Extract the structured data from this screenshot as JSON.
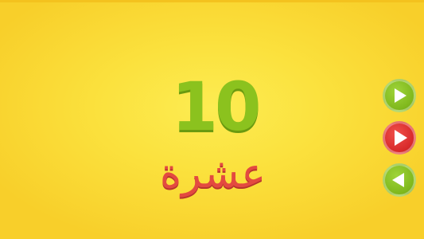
{
  "card": {
    "numeral": "10",
    "word": "عشرة"
  },
  "colors": {
    "background": "#fbe13d",
    "numeral": "#8bc21e",
    "word": "#e34a40",
    "nav_green": "#7fb81c",
    "play_red": "#d8292a"
  },
  "controls": {
    "next_icon": "next-arrow-icon",
    "play_icon": "play-icon",
    "prev_icon": "back-arrow-icon"
  }
}
